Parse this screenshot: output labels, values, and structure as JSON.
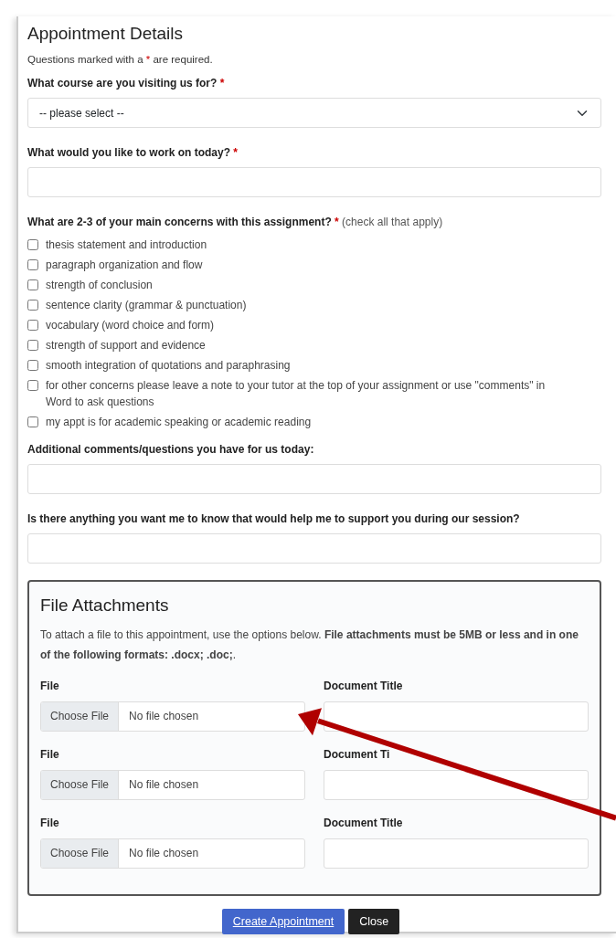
{
  "title": "Appointment Details",
  "required_note": {
    "before": "Questions marked with a",
    "mark": "*",
    "after": "are required."
  },
  "questions": [
    {
      "kind": "select",
      "label": "What course are you visiting us for?",
      "required": true,
      "placeholder": "-- please select --"
    },
    {
      "kind": "text",
      "label": "What would you like to work on today?",
      "required": true
    },
    {
      "kind": "checklist",
      "label": "What are 2-3 of your main concerns with this assignment?",
      "required": true,
      "hint": "(check all that apply)",
      "options": [
        {
          "label": "thesis statement and introduction",
          "checked": false
        },
        {
          "label": "paragraph organization and flow",
          "checked": false
        },
        {
          "label": "strength of conclusion",
          "checked": false
        },
        {
          "label": "sentence clarity (grammar & punctuation)",
          "checked": false
        },
        {
          "label": "vocabulary (word choice and form)",
          "checked": false
        },
        {
          "label": "strength of support and evidence",
          "checked": false
        },
        {
          "label": "smooth integration of quotations and paraphrasing",
          "checked": false
        },
        {
          "label": "for other concerns please leave a note to your tutor at the top of your assignment or use \"comments\" in Word to ask questions",
          "checked": false
        },
        {
          "label": "my appt is for academic speaking or academic reading",
          "checked": false
        }
      ]
    },
    {
      "kind": "text",
      "label": "Additional comments/questions you have for us today:",
      "required": false
    },
    {
      "kind": "text",
      "label": "Is there anything you want me to know that would help me to support you during our session?",
      "required": false
    }
  ],
  "attachments": {
    "title": "File Attachments",
    "description": "To attach a file to this appointment, use the options below. **File attachments must be 5MB or less and in one of the following formats: .docx; .doc;**.",
    "rows": [
      {
        "file_label": "File",
        "button": "Choose File",
        "status": "No file chosen",
        "title_label": "Document Title"
      },
      {
        "file_label": "File",
        "button": "Choose File",
        "status": "No file chosen",
        "title_label": "Document Ti"
      },
      {
        "file_label": "File",
        "button": "Choose File",
        "status": "No file chosen",
        "title_label": "Document Title"
      }
    ]
  },
  "buttons": [
    {
      "label": "Create Appointment",
      "kind": "primary"
    },
    {
      "label": "Close",
      "kind": "dark"
    }
  ]
}
